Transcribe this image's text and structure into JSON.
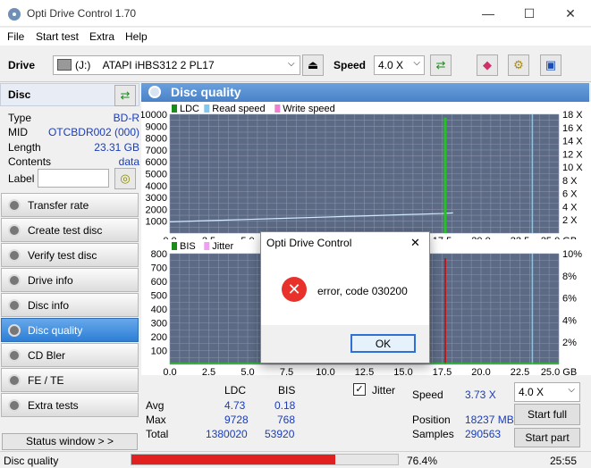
{
  "window": {
    "title": "Opti Drive Control 1.70",
    "minimize": "—",
    "maximize": "☐",
    "close": "✕"
  },
  "menu": [
    "File",
    "Start test",
    "Extra",
    "Help"
  ],
  "toolbar": {
    "drive_label": "Drive",
    "drive_letter": "(J:)",
    "drive_name": "ATAPI iHBS312  2 PL17",
    "speed_label": "Speed",
    "speed_value": "4.0 X"
  },
  "disc": {
    "header": "Disc",
    "fields": [
      {
        "k": "Type",
        "v": "BD-R"
      },
      {
        "k": "MID",
        "v": "OTCBDR002 (000)"
      },
      {
        "k": "Length",
        "v": "23.31 GB"
      },
      {
        "k": "Contents",
        "v": "data"
      }
    ],
    "label_key": "Label",
    "label_value": ""
  },
  "nav": [
    {
      "label": "Transfer rate"
    },
    {
      "label": "Create test disc"
    },
    {
      "label": "Verify test disc"
    },
    {
      "label": "Drive info"
    },
    {
      "label": "Disc info"
    },
    {
      "label": "Disc quality",
      "active": true
    },
    {
      "label": "CD Bler"
    },
    {
      "label": "FE / TE"
    },
    {
      "label": "Extra tests"
    }
  ],
  "status_window_btn": "Status window > >",
  "panel_title": "Disc quality",
  "chart_data": [
    {
      "type": "line",
      "legend": [
        "LDC",
        "Read speed",
        "Write speed"
      ],
      "legend_colors": [
        "#1a8c1a",
        "#80c8f0",
        "#f080d0"
      ],
      "yticks_left": [
        "10000",
        "9000",
        "8000",
        "7000",
        "6000",
        "5000",
        "4000",
        "3000",
        "2000",
        "1000"
      ],
      "yticks_right": [
        "18 X",
        "16 X",
        "14 X",
        "12 X",
        "10 X",
        "8 X",
        "6 X",
        "4 X",
        "2 X"
      ],
      "xticks": [
        "0.0",
        "2.5",
        "5.0",
        "7.5",
        "10.0",
        "12.5",
        "15.0",
        "17.5",
        "20.0",
        "22.5",
        "25.0 GB"
      ],
      "ylim": [
        0,
        10000
      ],
      "xlim": [
        0,
        25
      ],
      "read_speed_x": [
        0,
        2.5,
        5,
        7.5,
        10,
        12.5,
        15,
        17.5,
        18.2
      ],
      "read_speed_y": [
        1.9,
        2.1,
        2.3,
        2.5,
        2.7,
        2.9,
        3.1,
        3.3,
        3.4
      ],
      "ldc_spike_x": 17.7,
      "ldc_spike_y": 9728,
      "marker_x": 23.3
    },
    {
      "type": "line",
      "legend": [
        "BIS",
        "Jitter"
      ],
      "legend_colors": [
        "#1a8c1a",
        "#f0a0f0"
      ],
      "yticks_left": [
        "800",
        "700",
        "600",
        "500",
        "400",
        "300",
        "200",
        "100"
      ],
      "yticks_right": [
        "10%",
        "8%",
        "6%",
        "4%",
        "2%"
      ],
      "xticks": [
        "0.0",
        "2.5",
        "5.0",
        "7.5",
        "10.0",
        "12.5",
        "15.0",
        "17.5",
        "20.0",
        "22.5",
        "25.0 GB"
      ],
      "ylim": [
        0,
        800
      ],
      "xlim": [
        0,
        25
      ],
      "bis_spike_x": 17.7,
      "bis_spike_y": 768,
      "marker_x": 23.3
    }
  ],
  "stats": {
    "headers": [
      "LDC",
      "BIS"
    ],
    "rows": [
      {
        "k": "Avg",
        "ldc": "4.73",
        "bis": "0.18"
      },
      {
        "k": "Max",
        "ldc": "9728",
        "bis": "768"
      },
      {
        "k": "Total",
        "ldc": "1380020",
        "bis": "53920"
      }
    ],
    "jitter_label": "Jitter",
    "jitter_checked": true,
    "speed_label": "Speed",
    "speed_value": "3.73 X",
    "position_label": "Position",
    "position_value": "18237 MB",
    "samples_label": "Samples",
    "samples_value": "290563",
    "speed_select": "4.0 X",
    "start_full": "Start full",
    "start_part": "Start part"
  },
  "statusbar": {
    "text": "Disc quality",
    "progress_pct": "76.4%",
    "progress": 0.764,
    "time": "25:55"
  },
  "dialog": {
    "title": "Opti Drive Control",
    "message": "error, code 030200",
    "ok": "OK",
    "close": "✕"
  }
}
